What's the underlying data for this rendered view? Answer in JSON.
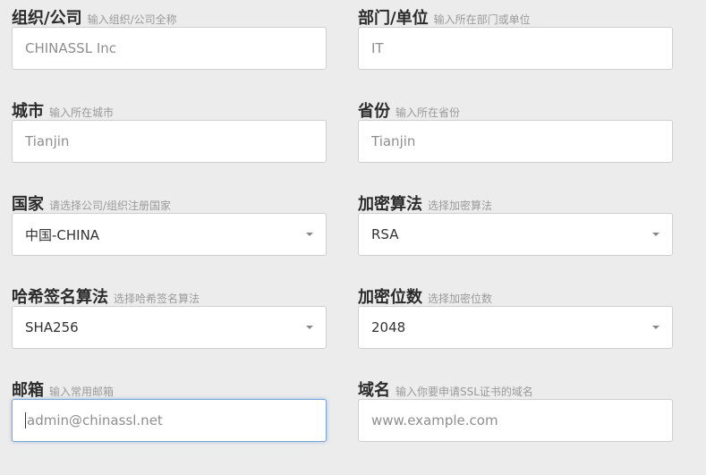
{
  "fields": {
    "organization": {
      "label": "组织/公司",
      "hint": "输入组织/公司全称",
      "value": "CHINASSL Inc"
    },
    "department": {
      "label": "部门/单位",
      "hint": "输入所在部门或单位",
      "value": "IT"
    },
    "city": {
      "label": "城市",
      "hint": "输入所在城市",
      "value": "Tianjin"
    },
    "province": {
      "label": "省份",
      "hint": "输入所在省份",
      "value": "Tianjin"
    },
    "country": {
      "label": "国家",
      "hint": "请选择公司/组织注册国家",
      "selected": "中国-CHINA"
    },
    "encryption_algorithm": {
      "label": "加密算法",
      "hint": "选择加密算法",
      "selected": "RSA"
    },
    "hash_algorithm": {
      "label": "哈希签名算法",
      "hint": "选择哈希签名算法",
      "selected": "SHA256"
    },
    "key_size": {
      "label": "加密位数",
      "hint": "选择加密位数",
      "selected": "2048"
    },
    "email": {
      "label": "邮箱",
      "hint": "输入常用邮箱",
      "placeholder": "admin@chinassl.net"
    },
    "domain": {
      "label": "域名",
      "hint": "输入你要申请SSL证书的域名",
      "placeholder": "www.example.com"
    }
  }
}
